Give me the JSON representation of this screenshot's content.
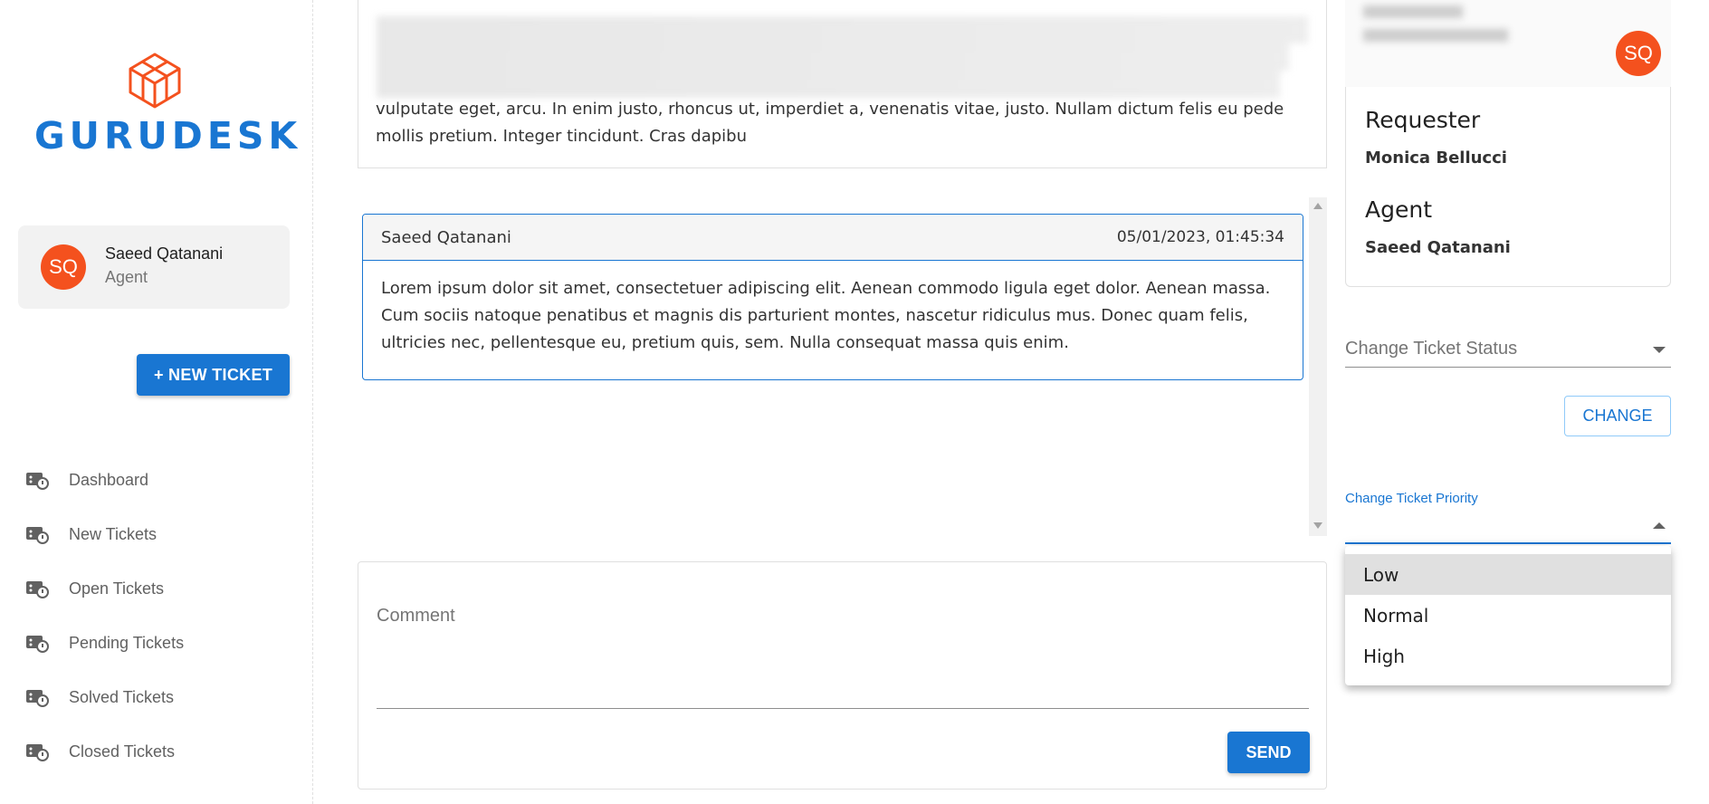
{
  "app": {
    "logo_text": "GURUDESK"
  },
  "sidebar": {
    "user": {
      "initials": "SQ",
      "name": "Saeed Qatanani",
      "role": "Agent"
    },
    "new_ticket_label": "+ NEW TICKET",
    "items": [
      {
        "label": "Dashboard",
        "icon": "ticket-icon"
      },
      {
        "label": "New Tickets",
        "icon": "ticket-icon"
      },
      {
        "label": "Open Tickets",
        "icon": "ticket-icon"
      },
      {
        "label": "Pending Tickets",
        "icon": "ticket-icon"
      },
      {
        "label": "Solved Tickets",
        "icon": "ticket-icon"
      },
      {
        "label": "Closed Tickets",
        "icon": "ticket-icon"
      }
    ]
  },
  "ticket": {
    "description_visible": "vulputate eget, arcu. In enim justo, rhoncus ut, imperdiet a, venenatis vitae, justo. Nullam dictum felis eu pede mollis pretium. Integer tincidunt. Cras dapibu"
  },
  "comments": [
    {
      "author": "Saeed Qatanani",
      "date": "05/01/2023, 01:45:34",
      "body": "Lorem ipsum dolor sit amet, consectetuer adipiscing elit. Aenean commodo ligula eget dolor. Aenean massa. Cum sociis natoque penatibus et magnis dis parturient montes, nascetur ridiculus mus. Donec quam felis, ultricies nec, pellentesque eu, pretium quis, sem. Nulla consequat massa quis enim."
    }
  ],
  "comment_form": {
    "placeholder": "Comment",
    "send_label": "SEND"
  },
  "header": {
    "avatar_initials": "SQ"
  },
  "details": {
    "requester_label": "Requester",
    "requester_value": "Monica Bellucci",
    "agent_label": "Agent",
    "agent_value": "Saeed Qatanani"
  },
  "status_control": {
    "placeholder": "Change Ticket Status",
    "button_label": "CHANGE"
  },
  "priority_control": {
    "label": "Change Ticket Priority",
    "options": [
      "Low",
      "Normal",
      "High"
    ],
    "highlighted": "Low"
  },
  "colors": {
    "primary": "#1976d2",
    "avatar": "#f4511e",
    "logo_icon": "#f4511e"
  }
}
